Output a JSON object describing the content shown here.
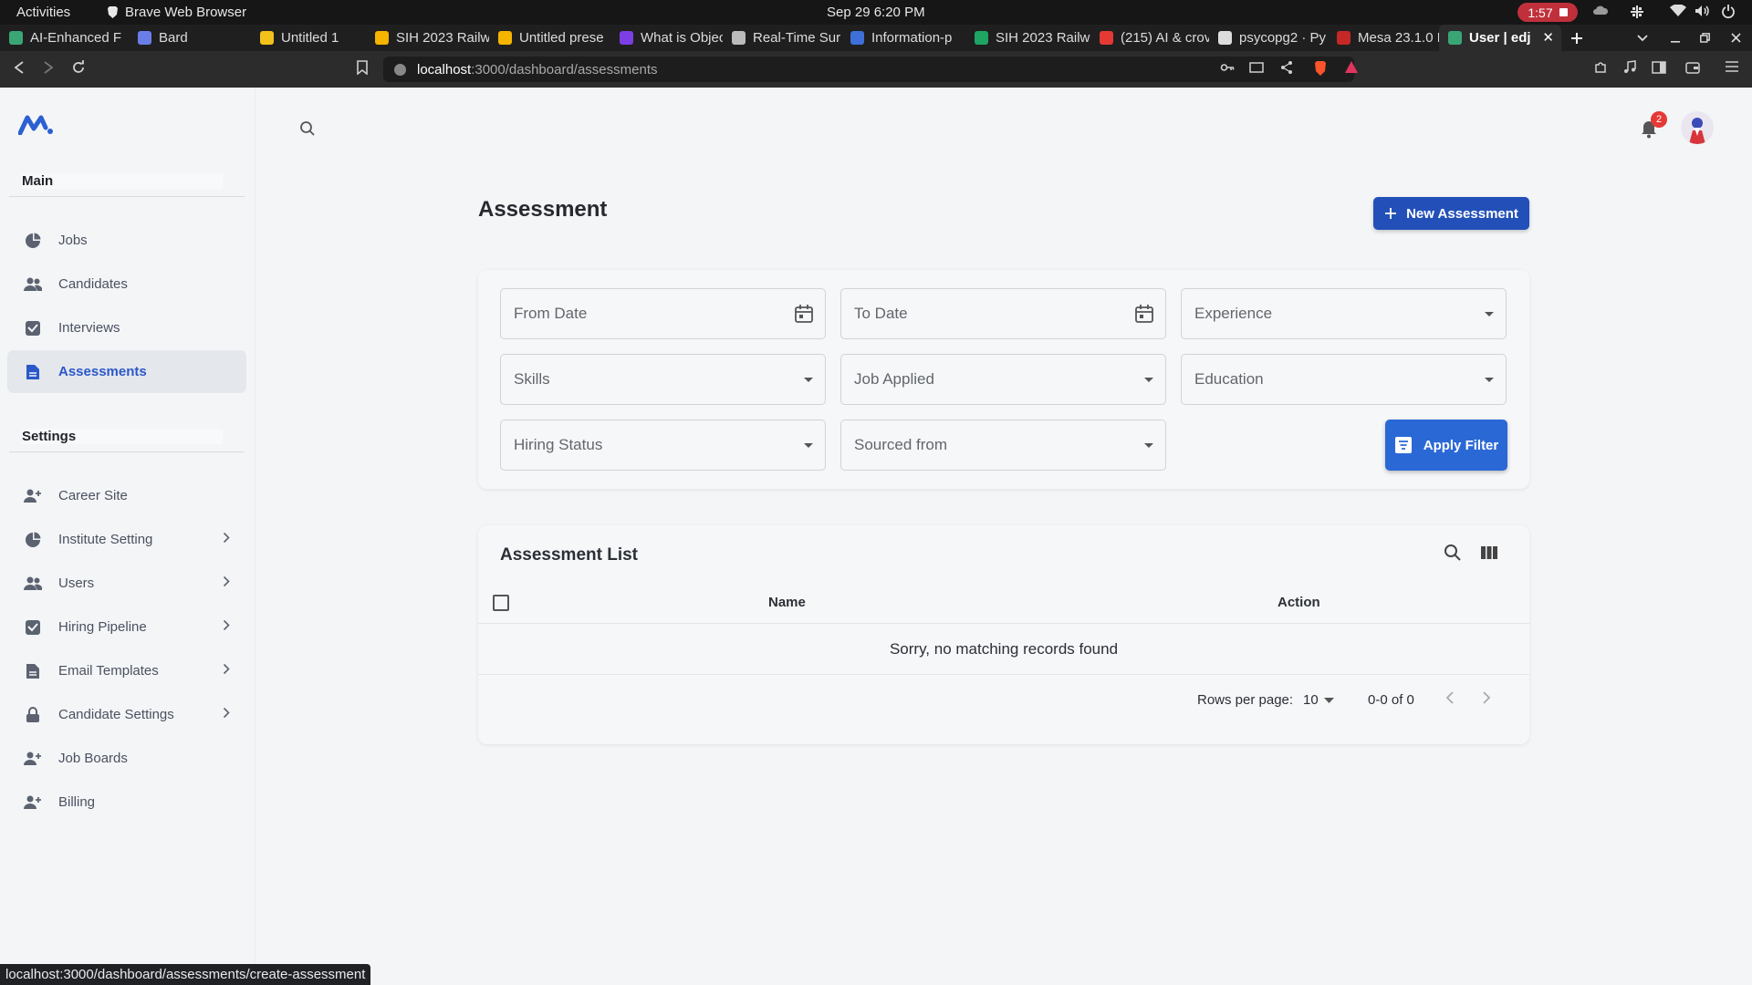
{
  "os": {
    "activities": "Activities",
    "app_name": "Brave Web Browser",
    "clock": "Sep 29  6:20 PM",
    "recording_time": "1:57"
  },
  "tabs": [
    {
      "label": "AI-Enhanced F",
      "color": "#3aa675"
    },
    {
      "label": "Bard",
      "color": "#6b7ee8"
    },
    {
      "label": "Untitled 1",
      "color": "#f2c21b"
    },
    {
      "label": "SIH 2023 Railw",
      "color": "#f4b400"
    },
    {
      "label": "Untitled prese",
      "color": "#f4b400"
    },
    {
      "label": "What is Objec",
      "color": "#7b3fe4"
    },
    {
      "label": "Real-Time Sur",
      "color": "#bbbbbb"
    },
    {
      "label": "Information-p",
      "color": "#3f6fd8"
    },
    {
      "label": "SIH 2023 Railw",
      "color": "#1fa463"
    },
    {
      "label": "(215) AI & crov",
      "color": "#e53935"
    },
    {
      "label": "psycopg2 · Py",
      "color": "#dddddd"
    },
    {
      "label": "Mesa 23.1.0 R",
      "color": "#c62828"
    },
    {
      "label": "User | edj",
      "color": "#3aa675",
      "active": true
    }
  ],
  "address": {
    "host": "localhost",
    "path": ":3000/dashboard/assessments"
  },
  "sidebar": {
    "main_label": "Main",
    "main_items": [
      {
        "label": "Jobs",
        "icon": "pie-chart-icon"
      },
      {
        "label": "Candidates",
        "icon": "people-icon"
      },
      {
        "label": "Interviews",
        "icon": "inbox-check-icon"
      },
      {
        "label": "Assessments",
        "icon": "document-icon",
        "active": true
      }
    ],
    "settings_label": "Settings",
    "settings_items": [
      {
        "label": "Career Site",
        "icon": "person-add-icon",
        "chevron": false
      },
      {
        "label": "Institute Setting",
        "icon": "pie-chart-icon",
        "chevron": true
      },
      {
        "label": "Users",
        "icon": "people-icon",
        "chevron": true
      },
      {
        "label": "Hiring Pipeline",
        "icon": "inbox-check-icon",
        "chevron": true
      },
      {
        "label": "Email Templates",
        "icon": "document-icon",
        "chevron": true
      },
      {
        "label": "Candidate Settings",
        "icon": "lock-icon",
        "chevron": true
      },
      {
        "label": "Job Boards",
        "icon": "person-add-icon",
        "chevron": false
      },
      {
        "label": "Billing",
        "icon": "person-add-icon",
        "chevron": false
      }
    ]
  },
  "header": {
    "notification_count": "2"
  },
  "page": {
    "title": "Assessment",
    "new_button": "New Assessment"
  },
  "filters": {
    "from_date": "From Date",
    "to_date": "To Date",
    "experience": "Experience",
    "skills": "Skills",
    "job_applied": "Job Applied",
    "education": "Education",
    "hiring_status": "Hiring Status",
    "sourced_from": "Sourced from",
    "apply_button": "Apply Filter"
  },
  "list": {
    "title": "Assessment List",
    "columns": {
      "name": "Name",
      "action": "Action"
    },
    "empty_message": "Sorry, no matching records found",
    "rows_per_page_label": "Rows per page:",
    "rows_per_page_value": "10",
    "range": "0-0 of 0"
  },
  "status_url": "localhost:3000/dashboard/assessments/create-assessment"
}
